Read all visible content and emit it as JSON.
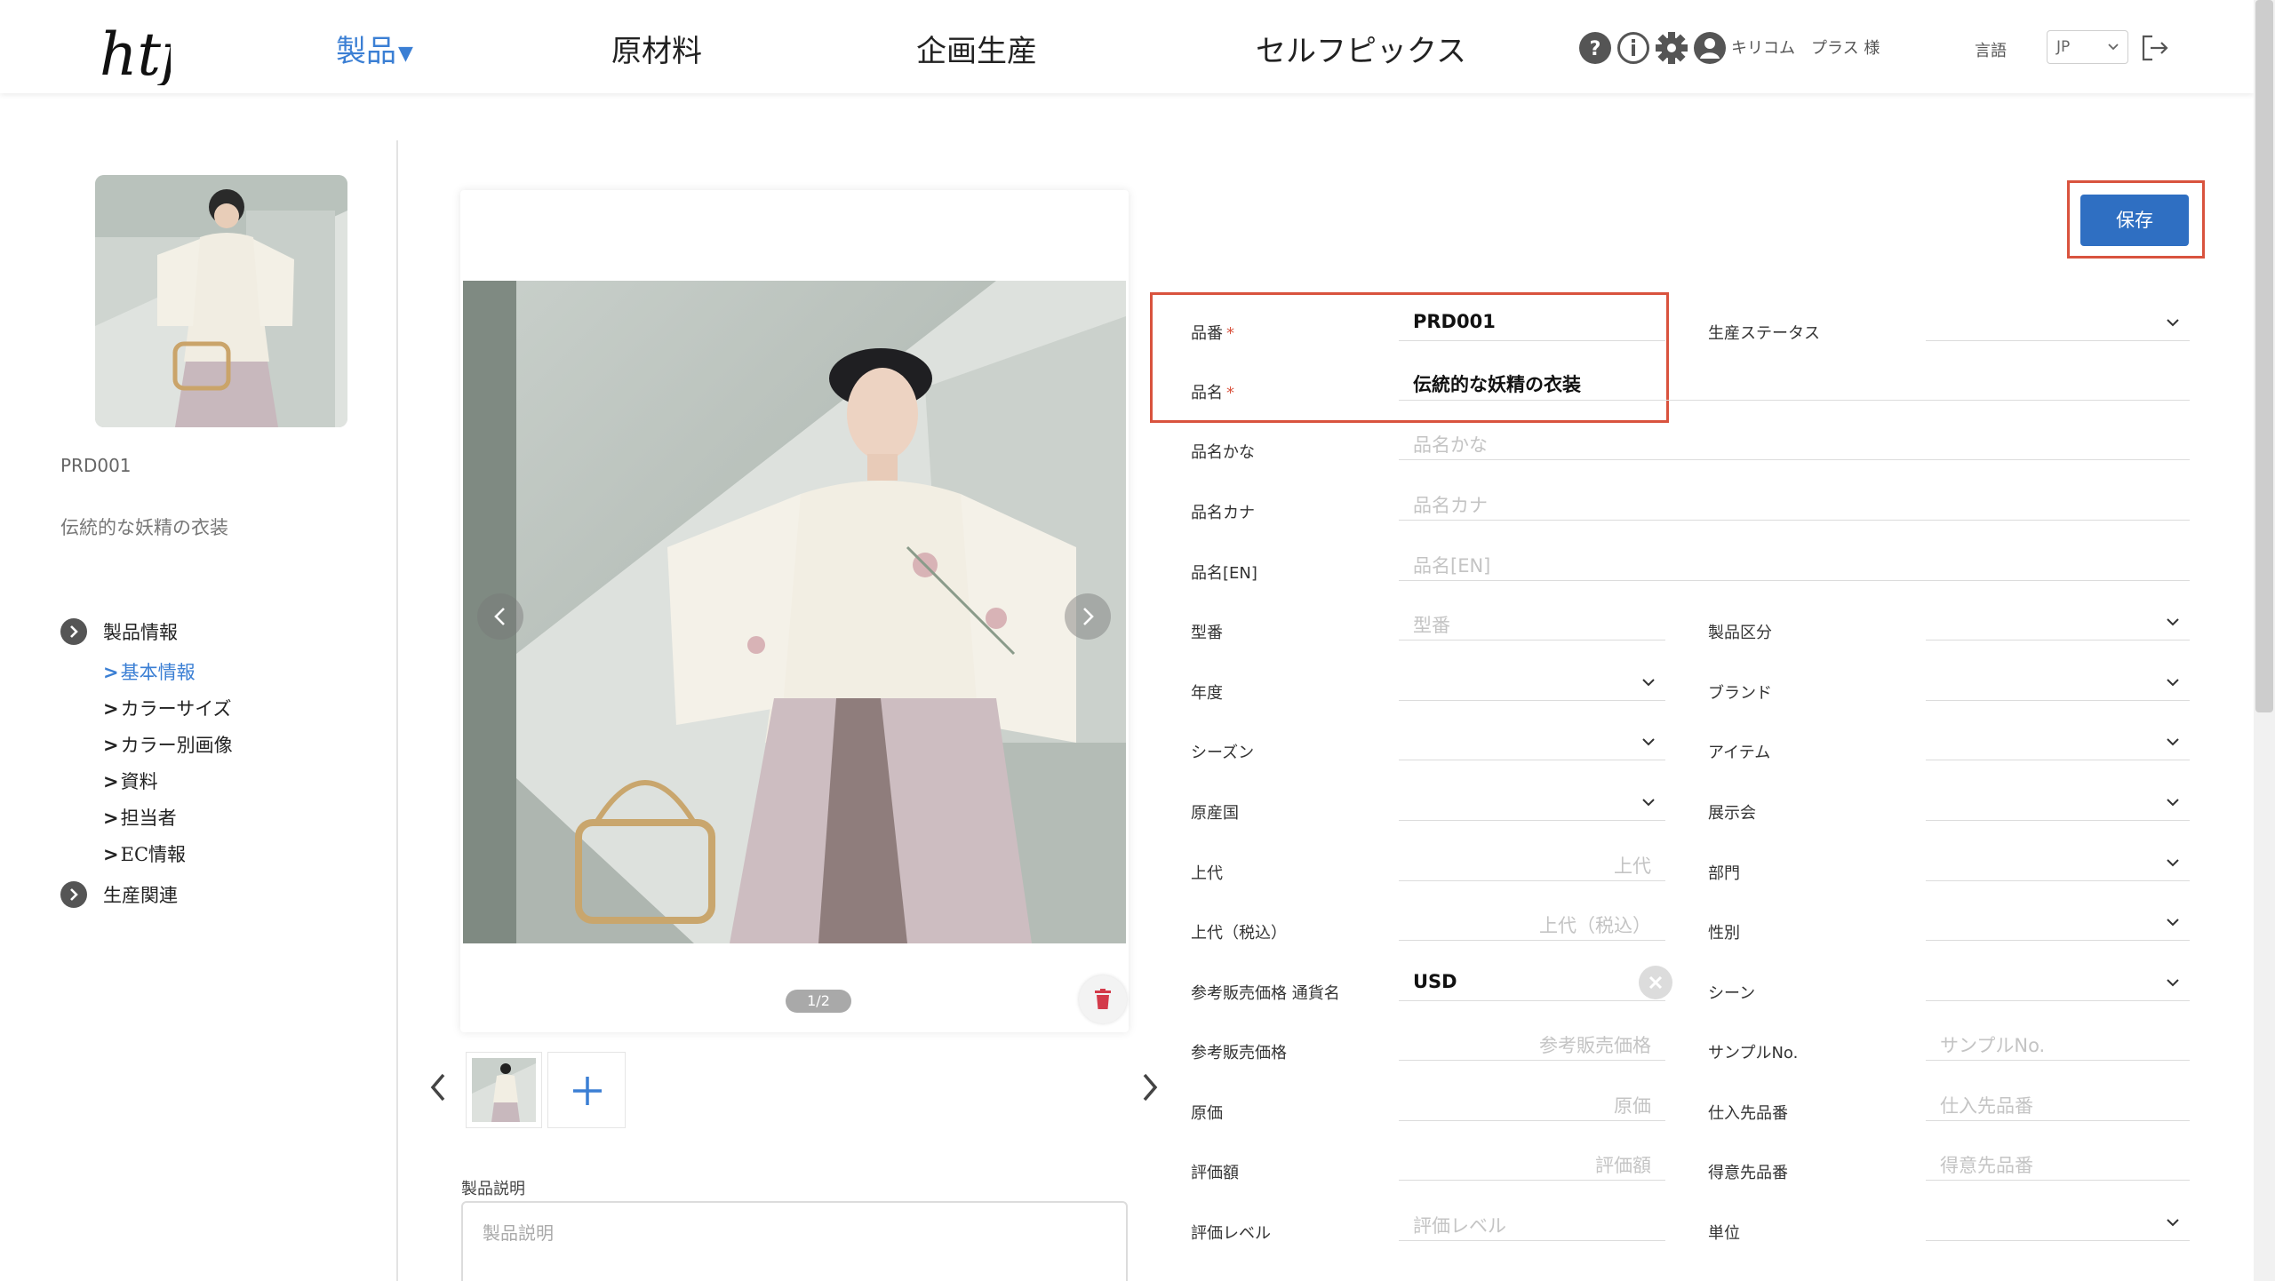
{
  "header": {
    "nav": [
      {
        "label": "製品",
        "active": true
      },
      {
        "label": "原材料"
      },
      {
        "label": "企画生産"
      },
      {
        "label": "セルフピックス"
      }
    ],
    "user_name": "キリコム　プラス 様",
    "language_label": "言語",
    "language_value": "JP",
    "icons": [
      "help-icon",
      "info-icon",
      "settings-icon",
      "user-icon",
      "logout-icon"
    ]
  },
  "sidebar": {
    "product_code": "PRD001",
    "product_name": "伝統的な妖精の衣装",
    "groups": [
      {
        "label": "製品情報",
        "items": [
          {
            "label": "基本情報",
            "active": true
          },
          {
            "label": "カラーサイズ"
          },
          {
            "label": "カラー別画像"
          },
          {
            "label": "資料"
          },
          {
            "label": "担当者"
          },
          {
            "label": "EC情報"
          }
        ]
      },
      {
        "label": "生産関連",
        "items": []
      }
    ],
    "item_prefix": ">"
  },
  "gallery": {
    "page_indicator": "1/2",
    "description_label": "製品説明",
    "description_placeholder": "製品説明"
  },
  "form": {
    "save_label": "保存",
    "required_mark": "*",
    "product_code": {
      "label": "品番",
      "value": "PRD001"
    },
    "product_name": {
      "label": "品名",
      "value": "伝統的な妖精の衣装"
    },
    "name_kana": {
      "label": "品名かな",
      "placeholder": "品名かな"
    },
    "name_katakana": {
      "label": "品名カナ",
      "placeholder": "品名カナ"
    },
    "name_en": {
      "label": "品名[EN]",
      "placeholder": "品名[EN]"
    },
    "model_no": {
      "label": "型番",
      "placeholder": "型番"
    },
    "year": {
      "label": "年度"
    },
    "season": {
      "label": "シーズン"
    },
    "origin": {
      "label": "原産国"
    },
    "retail_price": {
      "label": "上代",
      "placeholder": "上代"
    },
    "retail_price_tax": {
      "label": "上代（税込）",
      "placeholder": "上代（税込）"
    },
    "ref_currency": {
      "label": "参考販売価格 通貨名",
      "value": "USD"
    },
    "ref_price": {
      "label": "参考販売価格",
      "placeholder": "参考販売価格"
    },
    "cost": {
      "label": "原価",
      "placeholder": "原価"
    },
    "valuation": {
      "label": "評価額",
      "placeholder": "評価額"
    },
    "rating": {
      "label": "評価レベル",
      "placeholder": "評価レベル"
    },
    "prod_status": {
      "label": "生産ステータス"
    },
    "category": {
      "label": "製品区分"
    },
    "brand": {
      "label": "ブランド"
    },
    "item": {
      "label": "アイテム"
    },
    "exhibition": {
      "label": "展示会"
    },
    "department": {
      "label": "部門"
    },
    "gender": {
      "label": "性別"
    },
    "scene": {
      "label": "シーン"
    },
    "sample_no": {
      "label": "サンプルNo.",
      "placeholder": "サンプルNo."
    },
    "supplier_code": {
      "label": "仕入先品番",
      "placeholder": "仕入先品番"
    },
    "customer_code": {
      "label": "得意先品番",
      "placeholder": "得意先品番"
    },
    "unit": {
      "label": "単位"
    }
  },
  "colors": {
    "accent": "#3b7fd4",
    "save_button": "#2f6fc2",
    "highlight": "#d9533e",
    "trash": "#d33a4a"
  }
}
